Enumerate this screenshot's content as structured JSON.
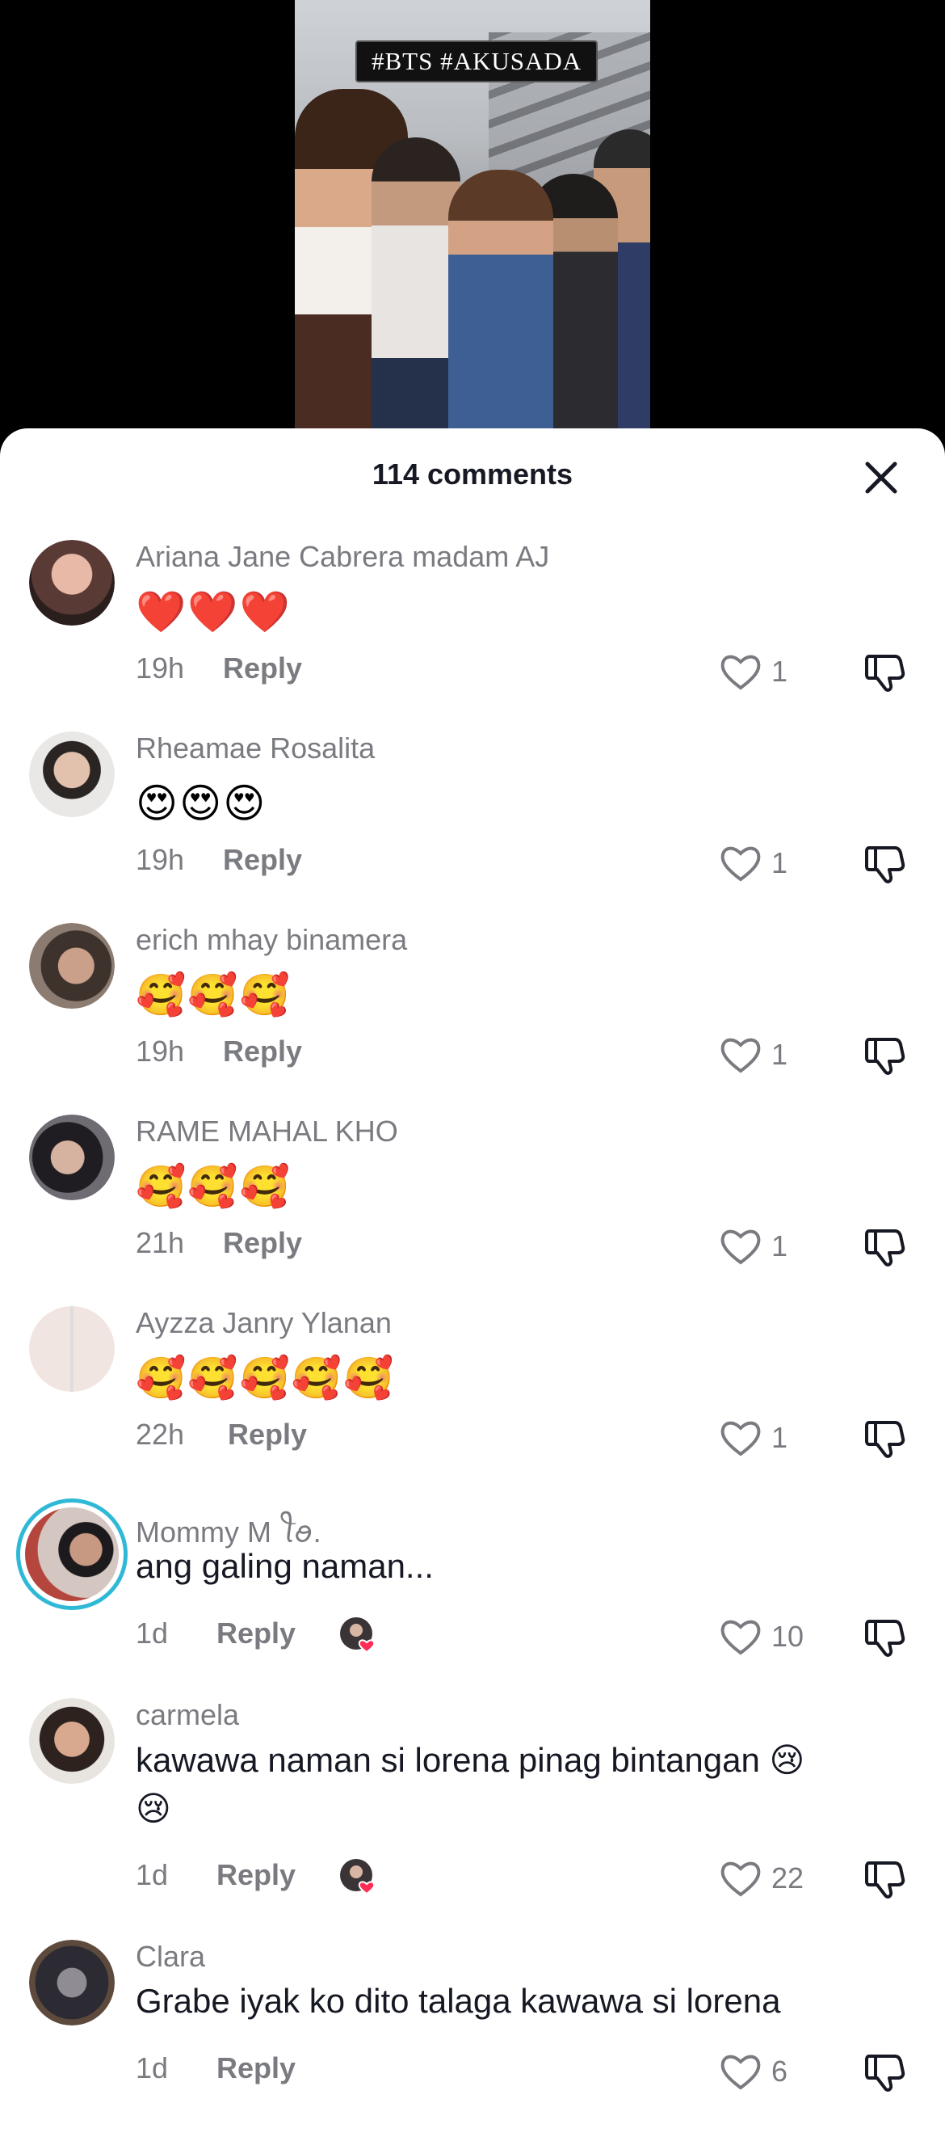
{
  "video": {
    "hashtags": "#BTS #AKUSADA"
  },
  "header": {
    "title": "114 comments"
  },
  "comments": [
    {
      "username": "Ariana Jane Cabrera  madam AJ",
      "text": "",
      "emojis": "❤️❤️❤️",
      "time": "19h",
      "reply": "Reply",
      "likes": "1",
      "avatar_color": "#5a3a34"
    },
    {
      "username": "Rheamae Rosalita",
      "text": "",
      "emojis": "😍😍😍",
      "time": "19h",
      "reply": "Reply",
      "likes": "1",
      "avatar_color": "#d9d6d2"
    },
    {
      "username": "erich mhay binamera",
      "text": "",
      "emojis": "🥰🥰🥰",
      "time": "19h",
      "reply": "Reply",
      "likes": "1",
      "avatar_color": "#6b5a4e"
    },
    {
      "username": "RAME MAHAL KHO",
      "text": "",
      "emojis": "🥰🥰🥰",
      "time": "21h",
      "reply": "Reply",
      "likes": "1",
      "avatar_color": "#4c4a52"
    },
    {
      "username": "Ayzza Janry Ylanan",
      "text": "",
      "emojis": "🥰🥰🥰🥰🥰",
      "time": "22h",
      "reply": "Reply",
      "likes": "1",
      "avatar_color": "#e3d6d0"
    },
    {
      "username": "Mommy M ꪻꪮ.",
      "text": "ang galing naman...",
      "emojis": "",
      "time": "1d",
      "reply": "Reply",
      "likes": "10",
      "avatar_color": "#8a5a52"
    },
    {
      "username": "carmela",
      "text": "kawawa naman si lorena pinag bintangan 😢",
      "text2": "😢",
      "emojis": "",
      "time": "1d",
      "reply": "Reply",
      "likes": "22",
      "avatar_color": "#7d5443"
    },
    {
      "username": "Clara",
      "text": "Grabe iyak ko dito talaga kawawa si lorena",
      "emojis": "",
      "time": "1d",
      "reply": "Reply",
      "likes": "6",
      "avatar_color": "#2c2a33"
    }
  ]
}
